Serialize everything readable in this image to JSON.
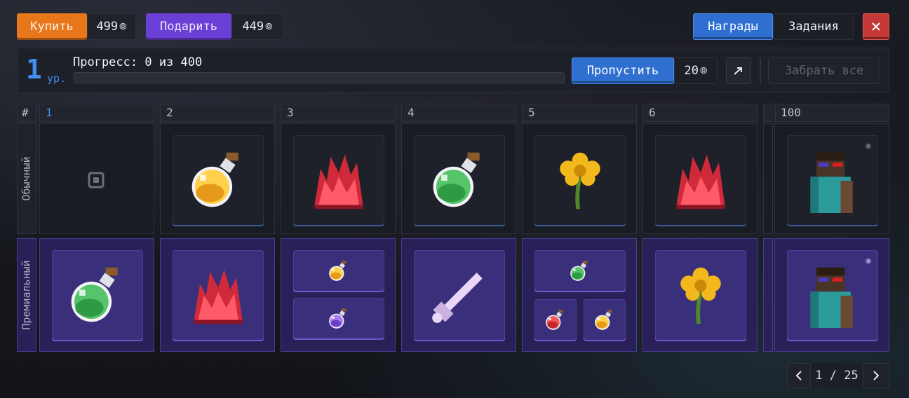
{
  "top_bar": {
    "buy_label": "Купить",
    "buy_price": "499",
    "gift_label": "Подарить",
    "gift_price": "449",
    "tab_rewards": "Награды",
    "tab_tasks": "Задания",
    "close_icon": "close-icon",
    "currency_icon": "coin-icon"
  },
  "progress": {
    "level": "1",
    "level_unit": "ур.",
    "text": "Прогресс: 0 из 400",
    "fraction": 0,
    "skip_label": "Пропустить",
    "skip_price": "20",
    "claim_all_label": "Забрать все"
  },
  "grid": {
    "hash_label": "#",
    "row_regular": "Обычный",
    "row_premium": "Премиальный",
    "columns": [
      {
        "number": "1",
        "regular": "locked-slot-icon",
        "premium": [
          "green-potion-icon"
        ]
      },
      {
        "number": "2",
        "regular": "orange-potion-icon",
        "premium": [
          "redstone-crystal-icon"
        ]
      },
      {
        "number": "3",
        "regular": "redstone-crystal-icon",
        "premium": [
          "orange-potion-icon",
          "purple-potion-icon"
        ]
      },
      {
        "number": "4",
        "regular": "green-potion-icon",
        "premium": [
          "bone-sword-icon"
        ]
      },
      {
        "number": "5",
        "regular": "yellow-flower-icon",
        "premium": [
          "green-potion-icon",
          "red-potion-icon",
          "orange-potion-icon"
        ]
      },
      {
        "number": "6",
        "regular": "redstone-crystal-icon",
        "premium": [
          "yellow-flower-icon"
        ]
      },
      {
        "number": "100",
        "regular": "player-skin-icon",
        "premium": [
          "player-skin-icon"
        ]
      }
    ]
  },
  "pagination": {
    "text": "1 / 25"
  },
  "colors": {
    "buy": "#e8771c",
    "gift": "#6a3fd6",
    "accent_blue": "#2f6fd0",
    "close": "#c43838",
    "premium": "#2a2058"
  }
}
